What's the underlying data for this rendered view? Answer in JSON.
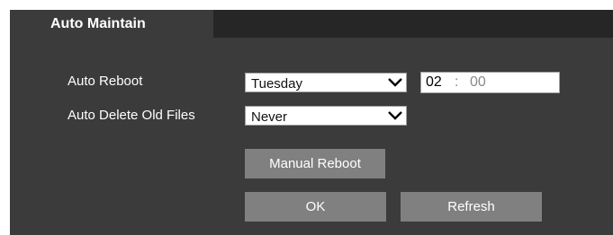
{
  "panel": {
    "tab_label": "Auto Maintain"
  },
  "auto_reboot": {
    "label": "Auto Reboot",
    "day_value": "Tuesday",
    "hour": "02",
    "separator": ":",
    "minute": "00"
  },
  "auto_delete": {
    "label": "Auto Delete Old Files",
    "value": "Never"
  },
  "buttons": {
    "manual_reboot": "Manual Reboot",
    "ok": "OK",
    "refresh": "Refresh"
  },
  "colors": {
    "panel_bg": "#3b3b3b",
    "tabbar_bg": "#262626",
    "button_bg": "#808080"
  }
}
